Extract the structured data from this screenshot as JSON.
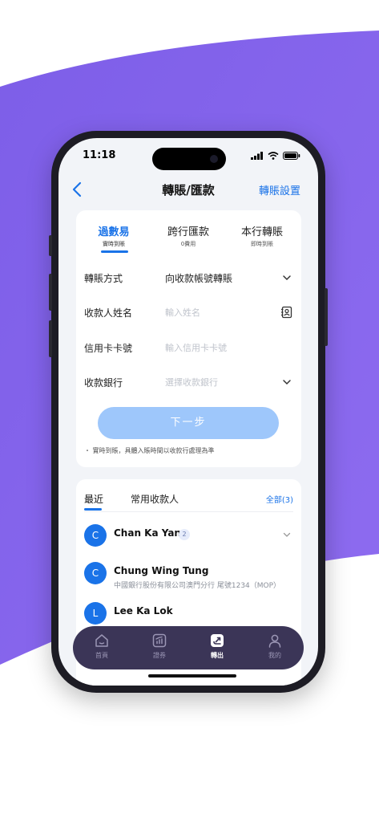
{
  "colors": {
    "accent": "#1a73e8",
    "background_wave": "#8463ea",
    "button_disabled": "#9ec7fb",
    "tabbar": "#3b3557"
  },
  "status_bar": {
    "time": "11:18"
  },
  "nav": {
    "title": "轉賬/匯款",
    "settings_label": "轉賬設置",
    "back_icon": "chevron-left-icon"
  },
  "transfer_tabs": [
    {
      "label": "過數易",
      "sub": "實時到賬",
      "active": true
    },
    {
      "label": "跨行匯款",
      "sub": "0費用",
      "active": false
    },
    {
      "label": "本行轉賬",
      "sub": "即時到賬",
      "active": false
    }
  ],
  "form": {
    "method": {
      "label": "轉賬方式",
      "value": "向收款帳號轉賬"
    },
    "payee_name": {
      "label": "收款人姓名",
      "placeholder": "輸入姓名"
    },
    "card_number": {
      "label": "信用卡卡號",
      "placeholder": "輸入信用卡卡號"
    },
    "bank": {
      "label": "收款銀行",
      "placeholder": "選擇收款銀行"
    },
    "next_label": "下一步",
    "note": "・ 實時到賬，具體入賬時間以收款行處理為準"
  },
  "payees_section": {
    "recent_label": "最近",
    "common_label": "常用收款人",
    "all_label": "全部(3)",
    "items": [
      {
        "initial": "C",
        "name": "Chan Ka Yan",
        "badge": "2",
        "detail": ""
      },
      {
        "initial": "C",
        "name": "Chung Wing Tung",
        "badge": "",
        "detail": "中國銀行股份有限公司澳門分行 尾號1234（MOP）"
      },
      {
        "initial": "L",
        "name": "Lee Ka Lok",
        "badge": "",
        "detail": ""
      }
    ]
  },
  "tabbar": [
    {
      "label": "首頁",
      "icon": "home-icon",
      "active": false
    },
    {
      "label": "證券",
      "icon": "chart-icon",
      "active": false
    },
    {
      "label": "轉出",
      "icon": "transfer-icon",
      "active": true
    },
    {
      "label": "我的",
      "icon": "user-icon",
      "active": false
    }
  ]
}
